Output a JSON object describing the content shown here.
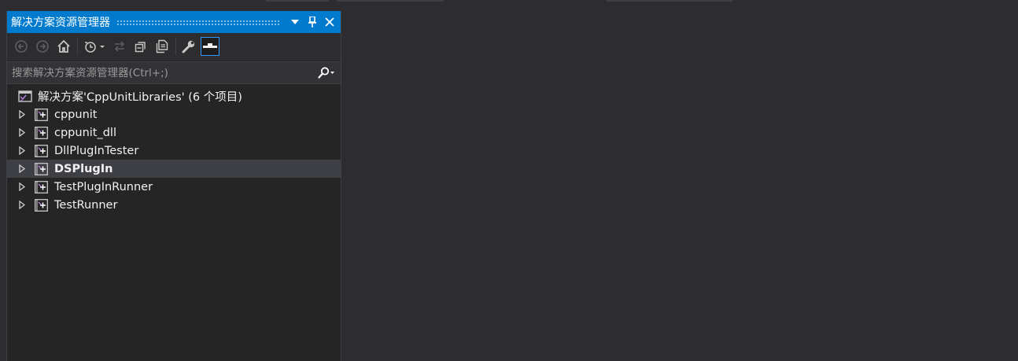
{
  "panel": {
    "title": "解决方案资源管理器",
    "title_buttons": [
      {
        "name": "dropdown-arrow-icon",
        "glyph": "▾"
      },
      {
        "name": "pin-icon",
        "glyph": "📌"
      },
      {
        "name": "close-icon",
        "glyph": "✕"
      }
    ]
  },
  "toolbar": {
    "tools": [
      "back-icon",
      "forward-icon",
      "home-icon",
      "history-icon",
      "sync-icon",
      "collapse-all-icon",
      "show-all-files-icon",
      "properties-icon",
      "preview-icon"
    ]
  },
  "search": {
    "placeholder": "搜索解决方案资源管理器(Ctrl+;)"
  },
  "tree": {
    "solution_label": "解决方案'CppUnitLibraries' (6 个项目)",
    "projects": [
      {
        "label": "cppunit"
      },
      {
        "label": "cppunit_dll"
      },
      {
        "label": "DllPlugInTester"
      },
      {
        "label": "DSPlugIn"
      },
      {
        "label": "TestPlugInRunner"
      },
      {
        "label": "TestRunner"
      }
    ]
  },
  "colors": {
    "accent": "#007acc",
    "background": "#2d2d30",
    "panel": "#252526",
    "selection": "#3f3f46"
  }
}
